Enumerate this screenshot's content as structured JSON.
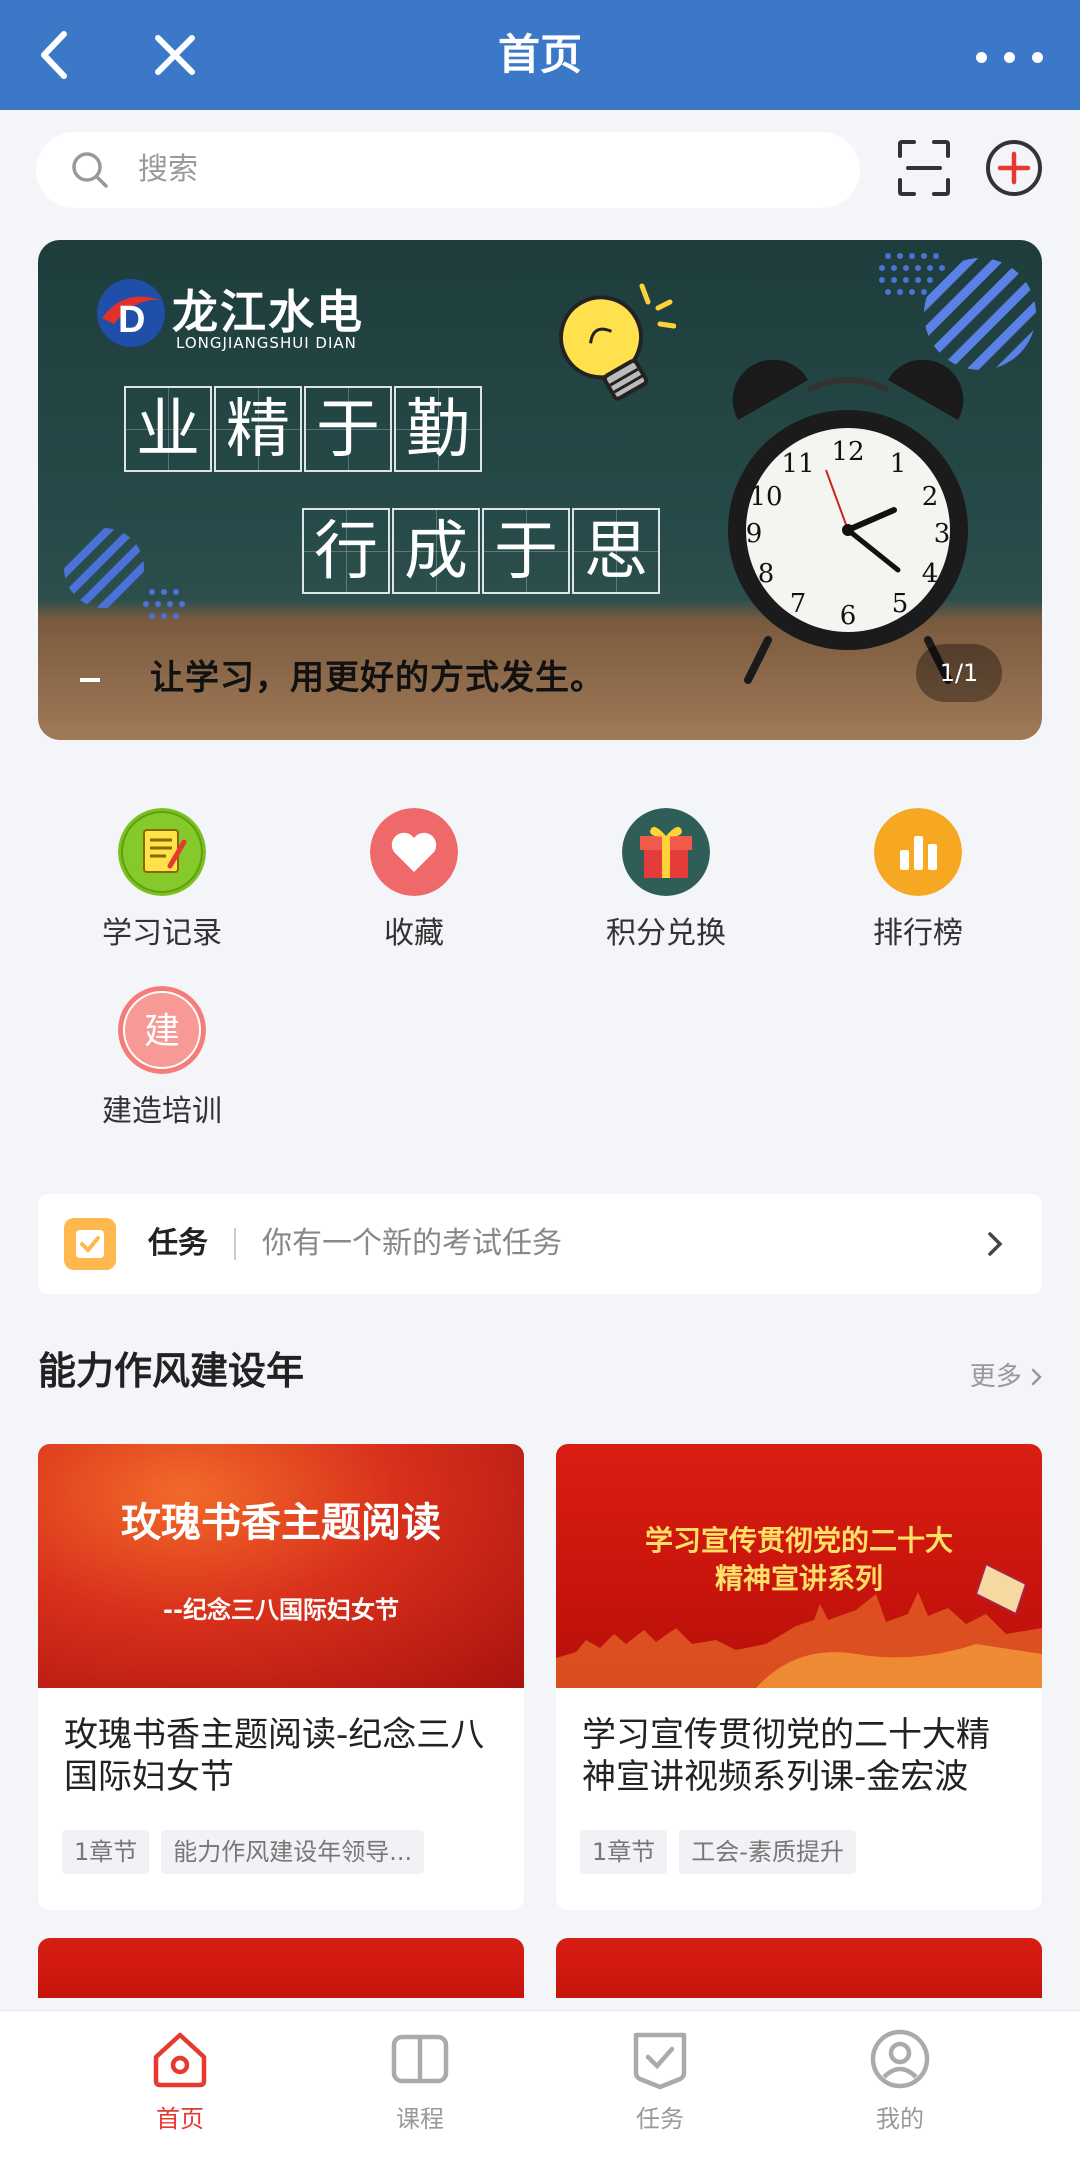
{
  "header": {
    "title": "首页"
  },
  "search": {
    "placeholder": "搜索"
  },
  "banner": {
    "logo_name": "龙江水电",
    "logo_sub": "LONGJIANGSHUI DIAN",
    "slogan_line1": [
      "业",
      "精",
      "于",
      "勤"
    ],
    "slogan_line2": [
      "行",
      "成",
      "于",
      "思"
    ],
    "tagline": "让学习，用更好的方式发生。",
    "page_indicator": "1/1"
  },
  "quick_entries": [
    {
      "label": "学习记录",
      "icon": "notebook-icon",
      "color": "#7cc11f"
    },
    {
      "label": "收藏",
      "icon": "heart-icon",
      "color": "#f0696a"
    },
    {
      "label": "积分兑换",
      "icon": "gift-icon",
      "color": "#2f5e58"
    },
    {
      "label": "排行榜",
      "icon": "bar-chart-icon",
      "color": "#f7a823"
    },
    {
      "label": "建造培训",
      "icon": "build-icon",
      "icon_text": "建",
      "color": "#f57c78"
    }
  ],
  "task": {
    "title": "任务",
    "text": "你有一个新的考试任务"
  },
  "section": {
    "title": "能力作风建设年",
    "more": "更多",
    "cards": [
      {
        "cover_title": "玫瑰书香主题阅读",
        "cover_sub": "--纪念三八国际妇女节",
        "title": "玫瑰书香主题阅读-纪念三八国际妇女节",
        "tags": [
          "1章节",
          "能力作风建设年领导..."
        ]
      },
      {
        "cover_title": "学习宣传贯彻党的二十大\n精神宣讲系列",
        "title": "学习宣传贯彻党的二十大精神宣讲视频系列课-金宏波",
        "tags": [
          "1章节",
          "工会-素质提升"
        ]
      }
    ]
  },
  "bottom_nav": [
    {
      "label": "首页",
      "icon": "home-icon",
      "active": true
    },
    {
      "label": "课程",
      "icon": "book-icon",
      "active": false
    },
    {
      "label": "任务",
      "icon": "task-check-icon",
      "active": false
    },
    {
      "label": "我的",
      "icon": "profile-icon",
      "active": false
    }
  ],
  "colors": {
    "header": "#3c78c8",
    "accent": "#e6392f",
    "background": "#f4f5f9"
  }
}
